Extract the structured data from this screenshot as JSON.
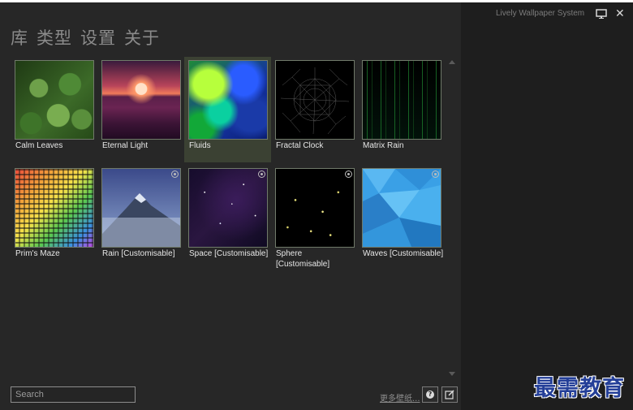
{
  "nav": {
    "library": "库",
    "type": "类型",
    "settings": "设置",
    "about": "关于"
  },
  "titlebar": {
    "app_name": "Lively Wallpaper System",
    "close_glyph": "✕"
  },
  "wallpapers": [
    {
      "name": "Calm Leaves",
      "customisable": false
    },
    {
      "name": "Eternal Light",
      "customisable": false
    },
    {
      "name": "Fluids",
      "customisable": false,
      "selected": true
    },
    {
      "name": "Fractal Clock",
      "customisable": false
    },
    {
      "name": "Matrix Rain",
      "customisable": false
    },
    {
      "name": "Prim's Maze",
      "customisable": false
    },
    {
      "name": "Rain [Customisable]",
      "customisable": true
    },
    {
      "name": "Space [Customisable]",
      "customisable": true
    },
    {
      "name": "Sphere [Customisable]",
      "customisable": true
    },
    {
      "name": "Waves [Customisable]",
      "customisable": true
    }
  ],
  "search": {
    "placeholder": "Search",
    "value": ""
  },
  "footer": {
    "more_wallpapers": "更多壁纸...",
    "help_glyph": "?"
  },
  "watermark": "最需教育",
  "colors": {
    "background": "#262626",
    "sidebar": "#1e1e1e",
    "selected_tile": "#3b4133",
    "watermark": "#243f98"
  }
}
